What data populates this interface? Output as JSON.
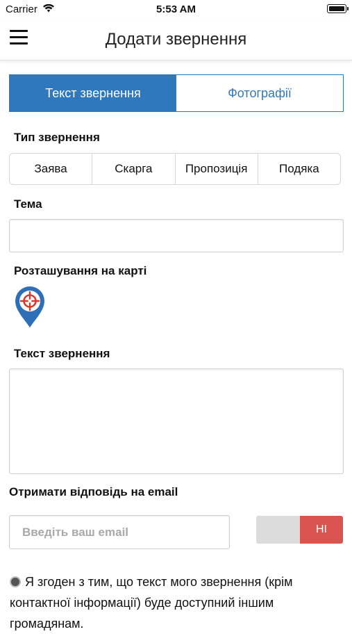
{
  "status_bar": {
    "carrier": "Carrier",
    "time": "5:53 AM"
  },
  "nav": {
    "title": "Додати звернення",
    "menu_icon": "hamburger-menu-icon"
  },
  "tabs": [
    {
      "label": "Текст звернення",
      "active": true
    },
    {
      "label": "Фотографії",
      "active": false
    }
  ],
  "appeal_type": {
    "label": "Тип звернення",
    "options": [
      "Заява",
      "Скарга",
      "Пропозиція",
      "Подяка"
    ]
  },
  "topic": {
    "label": "Тема",
    "value": ""
  },
  "location": {
    "label": "Розташування на карті",
    "icon": "map-pin-target-icon"
  },
  "appeal_text": {
    "label": "Текст звернення",
    "value": ""
  },
  "email_reply": {
    "label": "Отримати відповідь на email",
    "placeholder": "Введіть ваш email",
    "toggle_label": "НІ"
  },
  "consent": {
    "text": "Я згоден з тим, що текст мого звернення (крім контактної інформації) буде доступний іншим громадянам."
  },
  "colors": {
    "primary": "#2f78bd",
    "toggle_no": "#d9534f"
  }
}
